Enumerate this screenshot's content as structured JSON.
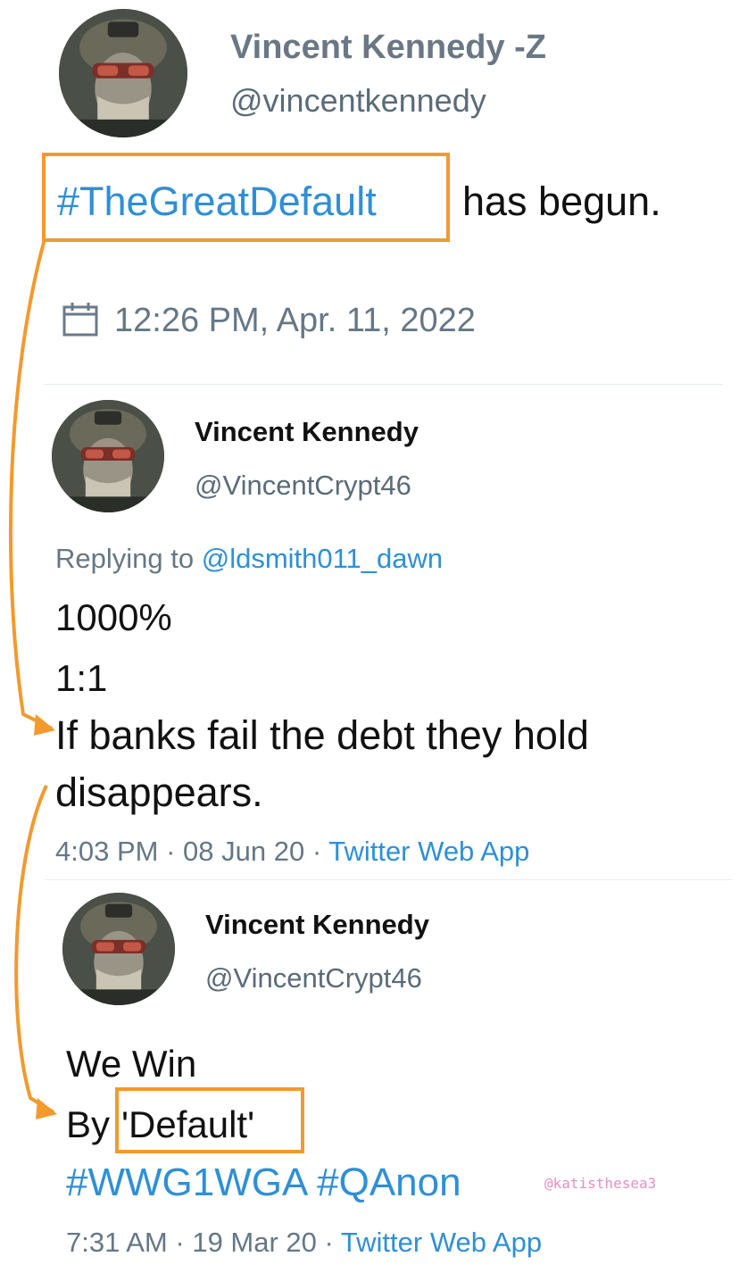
{
  "tweet1": {
    "display_name": "Vincent Kennedy -Z",
    "handle": "@vincentkennedy",
    "hashtag": "#TheGreatDefault",
    "text_rest": "has begun.",
    "date": "12:26 PM, Apr. 11, 2022",
    "icons": {
      "avatar": "soldier-avatar-icon",
      "calendar": "calendar-icon"
    }
  },
  "tweet2": {
    "display_name": "Vincent Kennedy",
    "handle": "@VincentCrypt46",
    "replying_prefix": "Replying to",
    "replying_to": "@ldsmith011_dawn",
    "lines": [
      "1000%",
      "1:1",
      "If banks fail the debt they hold",
      "disappears."
    ],
    "time": "4:03 PM",
    "date": "08 Jun 20",
    "separator": "·",
    "source": "Twitter Web App"
  },
  "tweet3": {
    "display_name": "Vincent Kennedy",
    "handle": "@VincentCrypt46",
    "line1": "We Win",
    "by_prefix": "By",
    "by_highlight": "'Default'",
    "hashtags": "#WWG1WGA #QAnon",
    "time": "7:31 AM",
    "date": "19 Mar 20",
    "separator": "·",
    "source": "Twitter Web App"
  },
  "watermark": "@katisthesea3",
  "colors": {
    "highlight": "#f29a2e",
    "link": "#2f8fd6",
    "watermark": "#e58fc0"
  }
}
